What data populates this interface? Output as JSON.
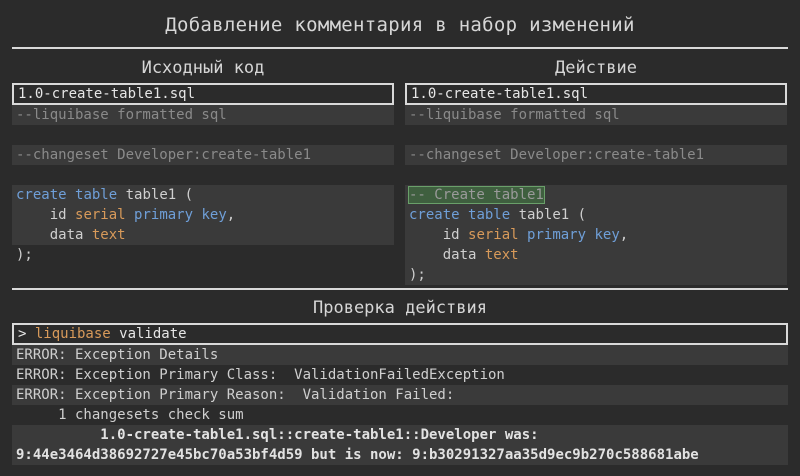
{
  "title": "Добавление комментария в набор изменений",
  "source": {
    "heading": "Исходный код",
    "filename": "1.0-create-table1.sql",
    "lines": {
      "l1": "--liquibase formatted sql",
      "l3": "--changeset Developer:create-table1",
      "create": "create",
      "table": "table",
      "table_name": " table1 (",
      "id": "    id ",
      "serial": "serial",
      "primary": "primary",
      "key": "key",
      "comma": ",",
      "data": "    data ",
      "text": "text",
      "close": ");"
    }
  },
  "action": {
    "heading": "Действие",
    "filename": "1.0-create-table1.sql",
    "lines": {
      "l1": "--liquibase formatted sql",
      "l3": "--changeset Developer:create-table1",
      "comment": "-- Create table1",
      "create": "create",
      "table": "table",
      "table_name": " table1 (",
      "id": "    id ",
      "serial": "serial",
      "primary": "primary",
      "key": "key",
      "comma": ",",
      "data": "    data ",
      "text": "text",
      "close": ");"
    }
  },
  "validation": {
    "heading": "Проверка действия",
    "prompt": "> ",
    "command": "liquibase",
    "command_arg": " validate",
    "out1": "ERROR: Exception Details",
    "out2": "ERROR: Exception Primary Class:  ValidationFailedException",
    "out3": "ERROR: Exception Primary Reason:  Validation Failed:",
    "out4": "     1 changesets check sum",
    "out5": "          1.0-create-table1.sql::create-table1::Developer was:",
    "out6": "9:44e3464d38692727e45bc70a53bf4d59 but is now: 9:b30291327aa35d9ec9b270c588681abe"
  },
  "colors": {
    "keyword": "#6f9fd8",
    "type": "#d89a5a",
    "comment": "#8a8a8a",
    "highlight": "#3f5f3f"
  }
}
